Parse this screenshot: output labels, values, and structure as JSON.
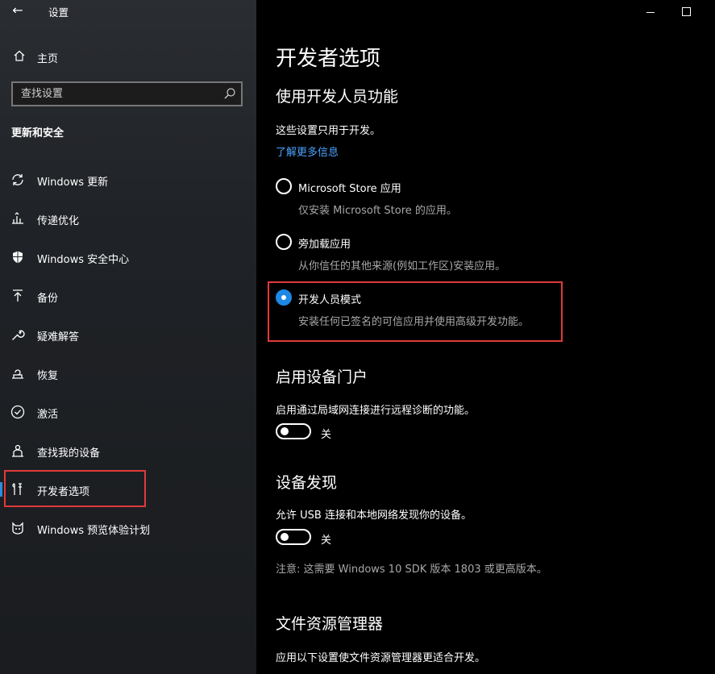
{
  "app": {
    "title": "设置",
    "back_icon": "back-arrow-icon"
  },
  "sidebar": {
    "home_label": "主页",
    "search_placeholder": "查找设置",
    "section_title": "更新和安全",
    "items": [
      {
        "label": "Windows 更新",
        "icon": "sync-icon"
      },
      {
        "label": "传递优化",
        "icon": "delivery-optimization-icon"
      },
      {
        "label": "Windows 安全中心",
        "icon": "shield-icon"
      },
      {
        "label": "备份",
        "icon": "backup-arrow-icon"
      },
      {
        "label": "疑难解答",
        "icon": "wrench-icon"
      },
      {
        "label": "恢复",
        "icon": "recovery-icon"
      },
      {
        "label": "激活",
        "icon": "check-circle-icon"
      },
      {
        "label": "查找我的设备",
        "icon": "person-locate-icon"
      },
      {
        "label": "开发者选项",
        "icon": "developer-tools-icon",
        "active": true
      },
      {
        "label": "Windows 预览体验计划",
        "icon": "insider-cat-icon"
      }
    ]
  },
  "main": {
    "page_title": "开发者选项",
    "dev_features": {
      "heading": "使用开发人员功能",
      "description": "这些设置只用于开发。",
      "learn_more": "了解更多信息",
      "options": [
        {
          "label": "Microsoft Store 应用",
          "sub": "仅安装 Microsoft Store 的应用。",
          "selected": false
        },
        {
          "label": "旁加载应用",
          "sub": "从你信任的其他来源(例如工作区)安装应用。",
          "selected": false
        },
        {
          "label": "开发人员模式",
          "sub": "安装任何已签名的可信应用并使用高级开发功能。",
          "selected": true
        }
      ]
    },
    "device_portal": {
      "heading": "启用设备门户",
      "description": "启用通过局域网连接进行远程诊断的功能。",
      "toggle_state": "关"
    },
    "device_discovery": {
      "heading": "设备发现",
      "description": "允许 USB 连接和本地网络发现你的设备。",
      "toggle_state": "关",
      "note": "注意: 这需要 Windows 10 SDK 版本 1803 或更高版本。"
    },
    "file_explorer": {
      "heading": "文件资源管理器",
      "description": "应用以下设置使文件资源管理器更适合开发。"
    }
  },
  "colors": {
    "accent": "#1e88e5",
    "link": "#4aa3ff",
    "highlight": "#e03a3a"
  }
}
